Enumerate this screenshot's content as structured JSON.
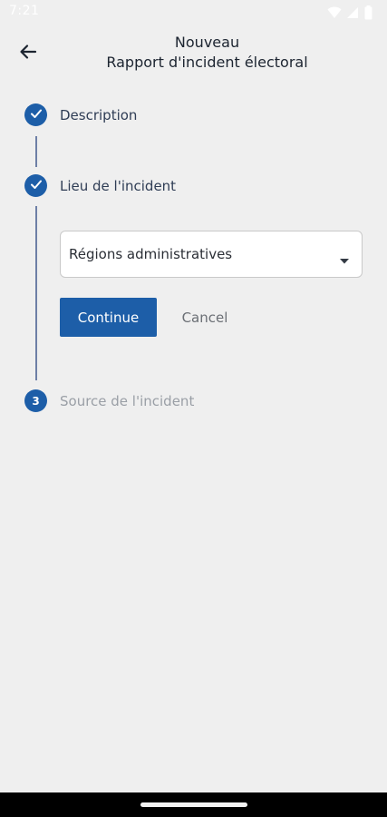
{
  "status_bar": {
    "time": "7:21",
    "icons": [
      "wifi-icon",
      "signal-icon",
      "battery-icon"
    ]
  },
  "header": {
    "title_line1": "Nouveau",
    "title_line2": "Rapport d'incident électoral",
    "back_icon": "arrow-left-icon"
  },
  "stepper": {
    "steps": [
      {
        "label": "Description",
        "state": "completed",
        "icon": "check-icon"
      },
      {
        "label": "Lieu de l'incident",
        "state": "completed",
        "icon": "check-icon"
      },
      {
        "label": "Source de l'incident",
        "state": "pending",
        "number": "3"
      }
    ]
  },
  "form": {
    "dropdown_value": "Régions administratives",
    "dropdown_icon": "caret-down-icon",
    "continue_label": "Continue",
    "cancel_label": "Cancel"
  },
  "colors": {
    "primary": "#1d5ea8",
    "background": "#efefef",
    "connector": "#6d7fa6",
    "inactive_text": "#9a9fa6"
  }
}
